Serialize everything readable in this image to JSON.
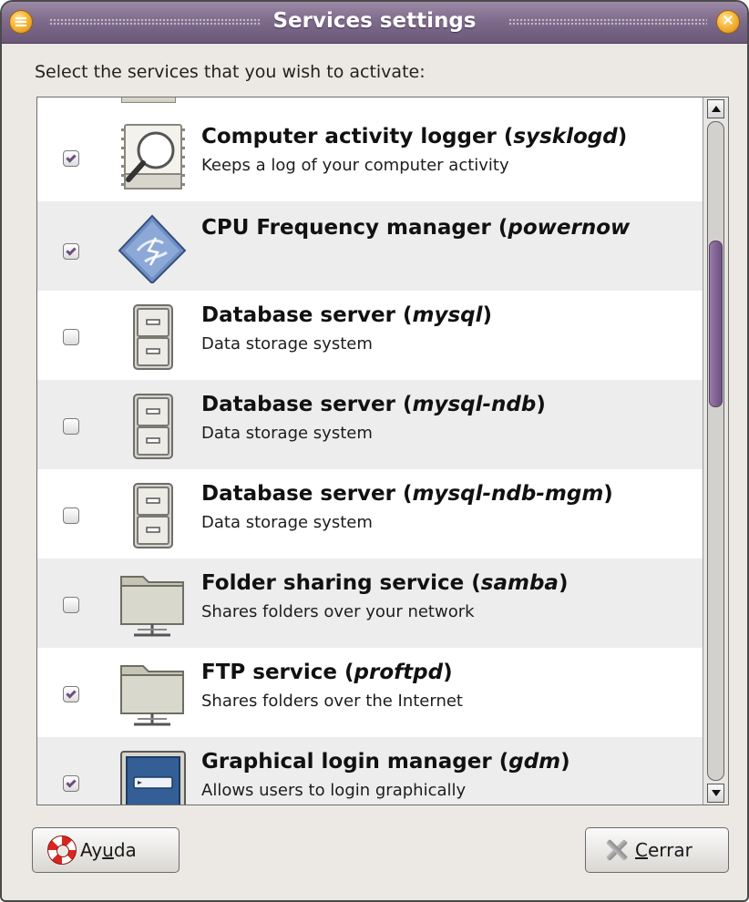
{
  "window": {
    "title": "Services settings"
  },
  "prompt": "Select the services that you wish to activate:",
  "services": [
    {
      "name_plain": "Computer activity logger (",
      "name_italic": "sysklogd",
      "name_tail": ")",
      "description": "Keeps a log of your computer activity",
      "checked": true,
      "icon": "log-viewer-icon"
    },
    {
      "name_plain": "CPU Frequency manager (",
      "name_italic": "powernow",
      "name_tail": "",
      "description": "",
      "checked": true,
      "icon": "cpu-frequency-icon"
    },
    {
      "name_plain": "Database server (",
      "name_italic": "mysql",
      "name_tail": ")",
      "description": "Data storage system",
      "checked": false,
      "icon": "file-cabinet-icon"
    },
    {
      "name_plain": "Database server (",
      "name_italic": "mysql-ndb",
      "name_tail": ")",
      "description": "Data storage system",
      "checked": false,
      "icon": "file-cabinet-icon"
    },
    {
      "name_plain": "Database server (",
      "name_italic": "mysql-ndb-mgm",
      "name_tail": ")",
      "description": "Data storage system",
      "checked": false,
      "icon": "file-cabinet-icon"
    },
    {
      "name_plain": "Folder sharing service (",
      "name_italic": "samba",
      "name_tail": ")",
      "description": "Shares folders over your network",
      "checked": false,
      "icon": "network-folder-icon"
    },
    {
      "name_plain": "FTP service (",
      "name_italic": "proftpd",
      "name_tail": ")",
      "description": "Shares folders over the Internet",
      "checked": true,
      "icon": "network-folder-icon"
    },
    {
      "name_plain": "Graphical login manager (",
      "name_italic": "gdm",
      "name_tail": ")",
      "description": "Allows users to login graphically",
      "checked": true,
      "icon": "login-screen-icon"
    }
  ],
  "buttons": {
    "help_pre": "Ay",
    "help_mnemonic": "u",
    "help_post": "da",
    "close_mnemonic": "C",
    "close_post": "errar"
  },
  "colors": {
    "titlebar": "#7f6b8b",
    "scroll_thumb": "#7d5f90",
    "checkmark": "#6d4f7d",
    "row_alt": "#ededed"
  }
}
